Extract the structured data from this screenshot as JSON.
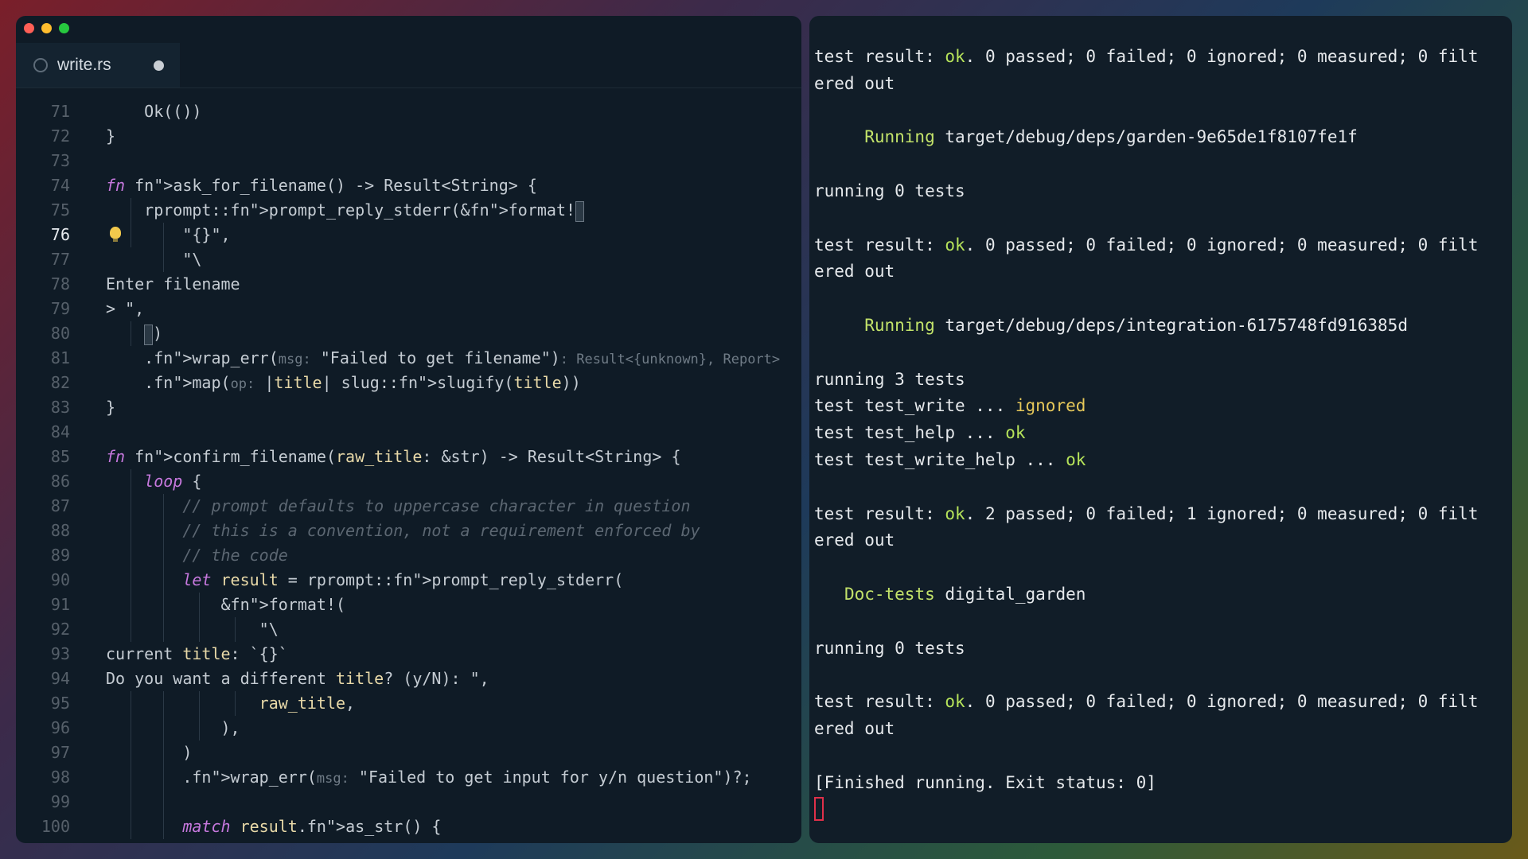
{
  "editor": {
    "tab": {
      "filename": "write.rs",
      "file_icon": "rust-icon",
      "modified": true
    },
    "lines": [
      {
        "n": "71",
        "t": "    Ok(())"
      },
      {
        "n": "72",
        "t": "}"
      },
      {
        "n": "73",
        "t": ""
      },
      {
        "n": "74",
        "t": "fn ask_for_filename() -> Result<String> {"
      },
      {
        "n": "75",
        "t": "    rprompt::prompt_reply_stderr(&format!"
      },
      {
        "n": "76",
        "t": "        \"{}\","
      },
      {
        "n": "77",
        "t": "        \"\\"
      },
      {
        "n": "78",
        "t": "Enter filename"
      },
      {
        "n": "79",
        "t": "> \","
      },
      {
        "n": "80",
        "t": "    )"
      },
      {
        "n": "81",
        "t": "    .wrap_err(msg: \"Failed to get filename\"): Result<{unknown}, Report>"
      },
      {
        "n": "82",
        "t": "    .map(op: |title| slug::slugify(title))"
      },
      {
        "n": "83",
        "t": "}"
      },
      {
        "n": "84",
        "t": ""
      },
      {
        "n": "85",
        "t": "fn confirm_filename(raw_title: &str) -> Result<String> {"
      },
      {
        "n": "86",
        "t": "    loop {"
      },
      {
        "n": "87",
        "t": "        // prompt defaults to uppercase character in question"
      },
      {
        "n": "88",
        "t": "        // this is a convention, not a requirement enforced by"
      },
      {
        "n": "89",
        "t": "        // the code"
      },
      {
        "n": "90",
        "t": "        let result = rprompt::prompt_reply_stderr("
      },
      {
        "n": "91",
        "t": "            &format!("
      },
      {
        "n": "92",
        "t": "                \"\\"
      },
      {
        "n": "93",
        "t": "current title: `{}`"
      },
      {
        "n": "94",
        "t": "Do you want a different title? (y/N): \","
      },
      {
        "n": "95",
        "t": "                raw_title,"
      },
      {
        "n": "96",
        "t": "            ),"
      },
      {
        "n": "97",
        "t": "        )"
      },
      {
        "n": "98",
        "t": "        .wrap_err(msg: \"Failed to get input for y/n question\")?;"
      },
      {
        "n": "99",
        "t": ""
      },
      {
        "n": "100",
        "t": "        match result.as_str() {"
      }
    ],
    "active_line": "76"
  },
  "terminal": {
    "lines": [
      {
        "parts": [
          [
            "test result: ",
            ""
          ],
          [
            "ok",
            "ok"
          ],
          [
            ". 0 passed; 0 failed; 0 ignored; 0 measured; 0 filt",
            ""
          ]
        ]
      },
      {
        "parts": [
          [
            "ered out",
            ""
          ]
        ]
      },
      {
        "parts": [
          [
            "",
            ""
          ]
        ]
      },
      {
        "parts": [
          [
            "     ",
            ""
          ],
          [
            "Running",
            "green"
          ],
          [
            " target/debug/deps/garden-9e65de1f8107fe1f",
            ""
          ]
        ]
      },
      {
        "parts": [
          [
            "",
            ""
          ]
        ]
      },
      {
        "parts": [
          [
            "running 0 tests",
            ""
          ]
        ]
      },
      {
        "parts": [
          [
            "",
            ""
          ]
        ]
      },
      {
        "parts": [
          [
            "test result: ",
            ""
          ],
          [
            "ok",
            "ok"
          ],
          [
            ". 0 passed; 0 failed; 0 ignored; 0 measured; 0 filt",
            ""
          ]
        ]
      },
      {
        "parts": [
          [
            "ered out",
            ""
          ]
        ]
      },
      {
        "parts": [
          [
            "",
            ""
          ]
        ]
      },
      {
        "parts": [
          [
            "     ",
            ""
          ],
          [
            "Running",
            "green"
          ],
          [
            " target/debug/deps/integration-6175748fd916385d",
            ""
          ]
        ]
      },
      {
        "parts": [
          [
            "",
            ""
          ]
        ]
      },
      {
        "parts": [
          [
            "running 3 tests",
            ""
          ]
        ]
      },
      {
        "parts": [
          [
            "test test_write ... ",
            ""
          ],
          [
            "ignored",
            "warn"
          ]
        ]
      },
      {
        "parts": [
          [
            "test test_help ... ",
            ""
          ],
          [
            "ok",
            "ok"
          ]
        ]
      },
      {
        "parts": [
          [
            "test test_write_help ... ",
            ""
          ],
          [
            "ok",
            "ok"
          ]
        ]
      },
      {
        "parts": [
          [
            "",
            ""
          ]
        ]
      },
      {
        "parts": [
          [
            "test result: ",
            ""
          ],
          [
            "ok",
            "ok"
          ],
          [
            ". 2 passed; 0 failed; 1 ignored; 0 measured; 0 filt",
            ""
          ]
        ]
      },
      {
        "parts": [
          [
            "ered out",
            ""
          ]
        ]
      },
      {
        "parts": [
          [
            "",
            ""
          ]
        ]
      },
      {
        "parts": [
          [
            "   ",
            ""
          ],
          [
            "Doc-tests",
            "green"
          ],
          [
            " digital_garden",
            ""
          ]
        ]
      },
      {
        "parts": [
          [
            "",
            ""
          ]
        ]
      },
      {
        "parts": [
          [
            "running 0 tests",
            ""
          ]
        ]
      },
      {
        "parts": [
          [
            "",
            ""
          ]
        ]
      },
      {
        "parts": [
          [
            "test result: ",
            ""
          ],
          [
            "ok",
            "ok"
          ],
          [
            ". 0 passed; 0 failed; 0 ignored; 0 measured; 0 filt",
            ""
          ]
        ]
      },
      {
        "parts": [
          [
            "ered out",
            ""
          ]
        ]
      },
      {
        "parts": [
          [
            "",
            ""
          ]
        ]
      },
      {
        "parts": [
          [
            "[Finished running. Exit status: 0]",
            ""
          ]
        ]
      }
    ]
  }
}
